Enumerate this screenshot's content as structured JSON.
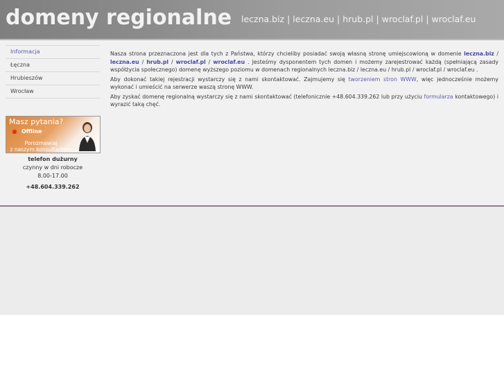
{
  "header": {
    "title": "domeny regionalne",
    "domains": [
      "leczna.biz",
      "leczna.eu",
      "hrub.pl",
      "wroclaf.pl",
      "wroclaf.eu"
    ],
    "separator": " | "
  },
  "sidebar": {
    "items": [
      {
        "label": "Informacja",
        "active": true
      },
      {
        "label": "Łęczna",
        "active": false
      },
      {
        "label": "Hrubieszów",
        "active": false
      },
      {
        "label": "Wrocław",
        "active": false
      }
    ]
  },
  "banner": {
    "question": "Masz pytania?",
    "status": "Offline",
    "talk_line1": "Porozmawiaj",
    "talk_line2": "z naszym konsultantem",
    "icon": "person-icon"
  },
  "contact": {
    "label": "telefon dużurny",
    "hours_line1": "czynny w dni robocze",
    "hours_line2": "8.00-17.00",
    "phone": "+48.604.339.262"
  },
  "main": {
    "p1": {
      "t1": "Nasza strona przeznaczona jest dla tych z Państwa, którzy chcieliby posiadać swoją własną stronę umiejscowioną w domenie ",
      "d1": "leczna.biz",
      "s1": " / ",
      "d2": "leczna.eu",
      "s2": " / ",
      "d3": "hrub.pl",
      "s3": " / ",
      "d4": "wroclaf.pl",
      "s4": " / ",
      "d5": "wroclaf.eu",
      "t2": " . Jesteśmy dysponentem tych domen i możemy zarejestrować każdą (spełniającą zasady współżycia społecznego) domenę wyższego poziomu w domenach regionalnych leczna.biz / leczna.eu / hrub.pl / wroclaf.pl / wroclaf.eu ."
    },
    "p2": {
      "t1": "Aby dokonać takiej rejestracji wystarczy się z nami skontaktować. Zajmujemy się ",
      "link": "tworzeniem stron WWW",
      "t2": ", więc jednocześnie możemy wykonać i umieścić na serwerze waszą stronę WWW."
    },
    "p3": {
      "t1": "Aby zyskać domenę regionalną wystarczy się z nami skontaktować (telefonicznie +48.604.339.262 lub przy użyciu ",
      "link": "formularza",
      "t2": " kontaktowego) i wyrazić taką chęć."
    }
  },
  "colors": {
    "header_bg": "#8c8c8c",
    "content_bg": "#f1f1f1",
    "link": "#5a5ab0",
    "divider": "#8c7f8c"
  }
}
